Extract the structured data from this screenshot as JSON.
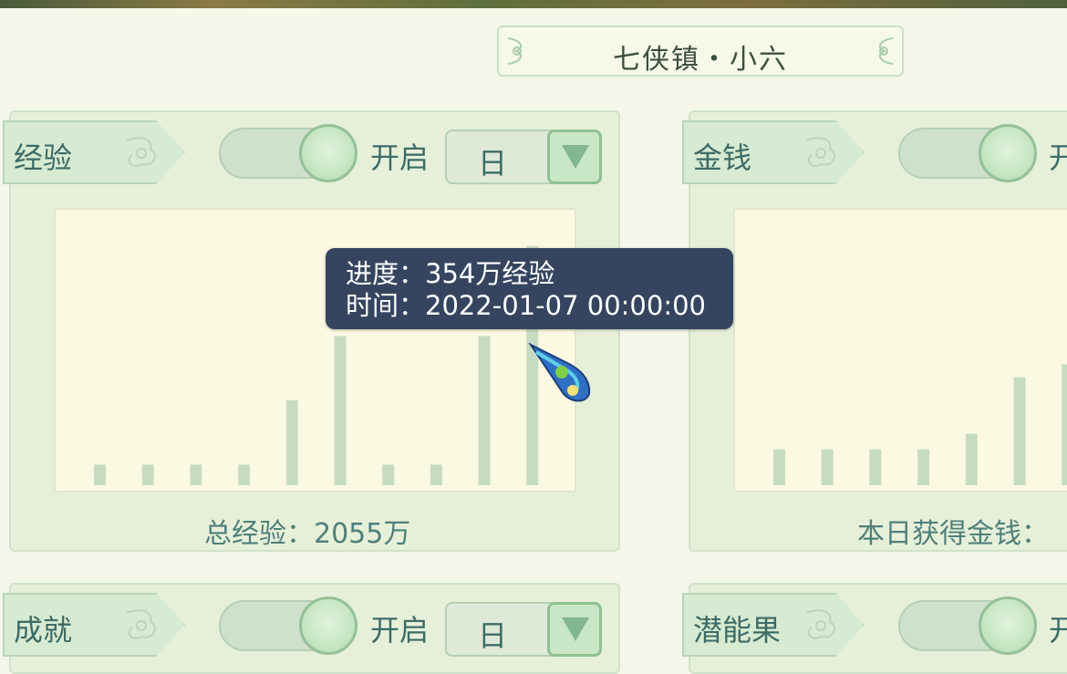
{
  "header": {
    "title": "七侠镇・小六"
  },
  "panels": {
    "experience": {
      "tag": "经验",
      "toggle_label": "开启",
      "period": "日",
      "summary": "总经验：2055万"
    },
    "money": {
      "tag": "金钱",
      "toggle_label": "开",
      "summary": "本日获得金钱："
    },
    "achievement": {
      "tag": "成就",
      "toggle_label": "开启",
      "period": "日"
    },
    "potential": {
      "tag": "潜能果",
      "toggle_label": "开"
    }
  },
  "tooltip": {
    "line1": "进度：354万经验",
    "line2": "时间：2022-01-07 00:00:00"
  },
  "chart_data": [
    {
      "type": "bar",
      "values": [
        0.08,
        0.08,
        0.08,
        0.08,
        0.33,
        0.58,
        0.08,
        0.08,
        0.58,
        0.93
      ]
    },
    {
      "type": "bar",
      "values": [
        0.14,
        0.14,
        0.14,
        0.14,
        0.2,
        0.42,
        0.47
      ]
    }
  ],
  "colors": {
    "bar": "#c6dcc0",
    "tooltip_bg": "#36455f",
    "accent": "#3d6b67"
  },
  "icons": {
    "dropdown": "triangle-down-icon",
    "ornament": "cloud-scroll-icon",
    "cursor": "feather-cursor-icon"
  }
}
